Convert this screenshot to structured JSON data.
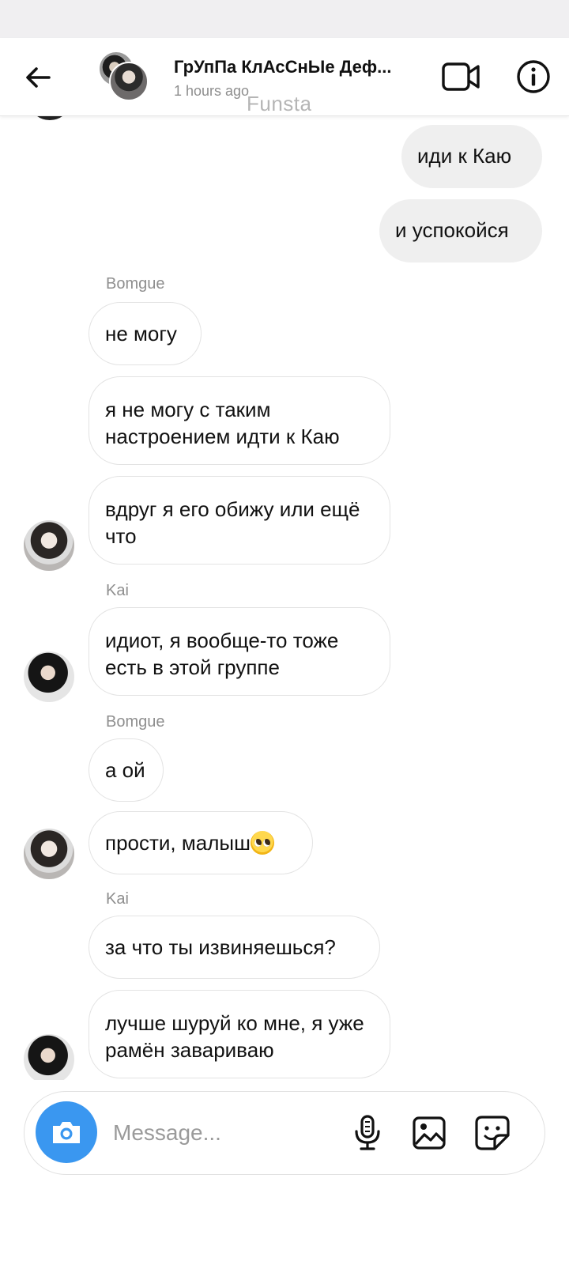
{
  "header": {
    "title": "ГрУпПа КлАсСнЫе Деф...",
    "subtitle": "1 hours ago",
    "watermark": "Funsta"
  },
  "messages": [
    {
      "side": "out",
      "text": "иди к Каю"
    },
    {
      "side": "out",
      "text": "и успокойся"
    },
    {
      "sender": "Bomgue"
    },
    {
      "side": "in",
      "text": "не могу"
    },
    {
      "side": "in",
      "text": "я не могу с таким настроением идти к Каю"
    },
    {
      "side": "in",
      "text": "вдруг я его обижу или ещё что",
      "avatar": "bomgue-avatar"
    },
    {
      "sender": "Kai"
    },
    {
      "side": "in",
      "text": "идиот, я вообще-то тоже есть в этой группе",
      "avatar": "kai-avatar"
    },
    {
      "sender": "Bomgue"
    },
    {
      "side": "in",
      "text": "а ой"
    },
    {
      "side": "in",
      "text": "прости, малыш",
      "emoji": "pleading-face-emoji",
      "avatar": "bomgue-avatar"
    },
    {
      "sender": "Kai"
    },
    {
      "side": "in",
      "text": "за что ты извиняешься?"
    },
    {
      "side": "in",
      "text": "лучше шуруй ко мне, я уже рамён завариваю",
      "avatar": "kai-avatar"
    }
  ],
  "composer": {
    "placeholder": "Message..."
  },
  "icons": {
    "back": "arrow-left-icon",
    "video": "video-camera-icon",
    "info": "info-icon",
    "camera": "camera-icon",
    "mic": "microphone-icon",
    "gallery": "image-icon",
    "sticker": "sticker-icon"
  },
  "colors": {
    "accent": "#3a97f0",
    "outgoing_bubble": "#efefef",
    "muted_text": "#8e8e8e"
  }
}
